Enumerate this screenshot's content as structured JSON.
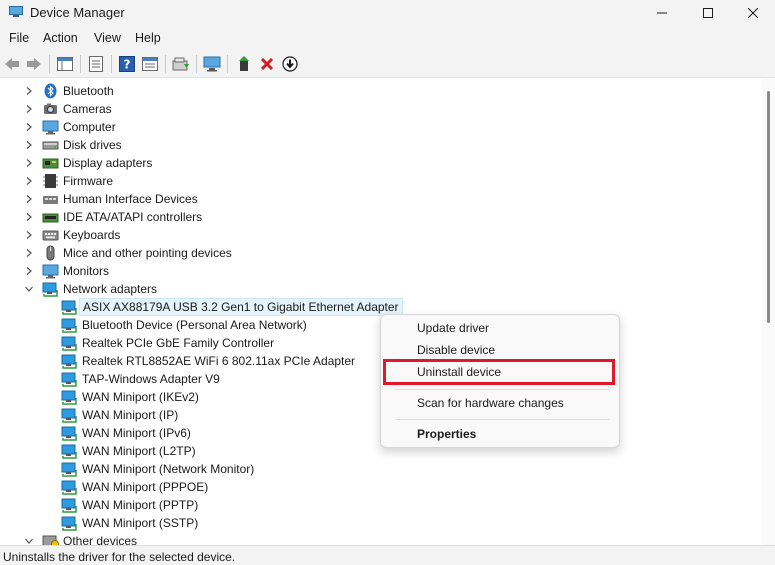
{
  "window": {
    "title": "Device Manager"
  },
  "menu": [
    "File",
    "Action",
    "View",
    "Help"
  ],
  "toolbar": {
    "icons": [
      "back-arrow-icon",
      "forward-arrow-icon",
      "show-hide-tree-icon",
      "properties-icon",
      "help-icon",
      "view-icon",
      "update-driver-icon",
      "scan-hardware-icon",
      "enable-device-icon",
      "uninstall-device-icon",
      "download-driver-icon"
    ]
  },
  "tree": {
    "categories": [
      {
        "label": "Bluetooth",
        "icon": "bluetooth-icon"
      },
      {
        "label": "Cameras",
        "icon": "camera-icon"
      },
      {
        "label": "Computer",
        "icon": "computer-icon"
      },
      {
        "label": "Disk drives",
        "icon": "disk-drive-icon"
      },
      {
        "label": "Display adapters",
        "icon": "display-adapter-icon"
      },
      {
        "label": "Firmware",
        "icon": "firmware-icon"
      },
      {
        "label": "Human Interface Devices",
        "icon": "hid-icon"
      },
      {
        "label": "IDE ATA/ATAPI controllers",
        "icon": "ide-controller-icon"
      },
      {
        "label": "Keyboards",
        "icon": "keyboard-icon"
      },
      {
        "label": "Mice and other pointing devices",
        "icon": "mouse-icon"
      },
      {
        "label": "Monitors",
        "icon": "monitor-icon"
      },
      {
        "label": "Network adapters",
        "icon": "network-adapter-icon",
        "expanded": true
      }
    ],
    "network_adapters": [
      "ASIX AX88179A USB 3.2 Gen1 to Gigabit Ethernet Adapter",
      "Bluetooth Device (Personal Area Network)",
      "Realtek PCIe GbE Family Controller",
      "Realtek RTL8852AE WiFi 6 802.11ax PCIe Adapter",
      "TAP-Windows Adapter V9",
      "WAN Miniport (IKEv2)",
      "WAN Miniport (IP)",
      "WAN Miniport (IPv6)",
      "WAN Miniport (L2TP)",
      "WAN Miniport (Network Monitor)",
      "WAN Miniport (PPPOE)",
      "WAN Miniport (PPTP)",
      "WAN Miniport (SSTP)"
    ],
    "selected_adapter": "ASIX AX88179A USB 3.2 Gen1 to Gigabit Ethernet Adapter",
    "next_category": "Other devices"
  },
  "context_menu": {
    "items": [
      "Update driver",
      "Disable device",
      "Uninstall device",
      "Scan for hardware changes",
      "Properties"
    ],
    "highlighted": "Uninstall device",
    "highlight_color": "#e0182b"
  },
  "status": {
    "text": "Uninstalls the driver for the selected device."
  },
  "colors": {
    "chrome": "#f3f3f3",
    "selection": "#e5f3fb",
    "network_icon": "#1f8fd6",
    "annotation": "#e0182b"
  }
}
